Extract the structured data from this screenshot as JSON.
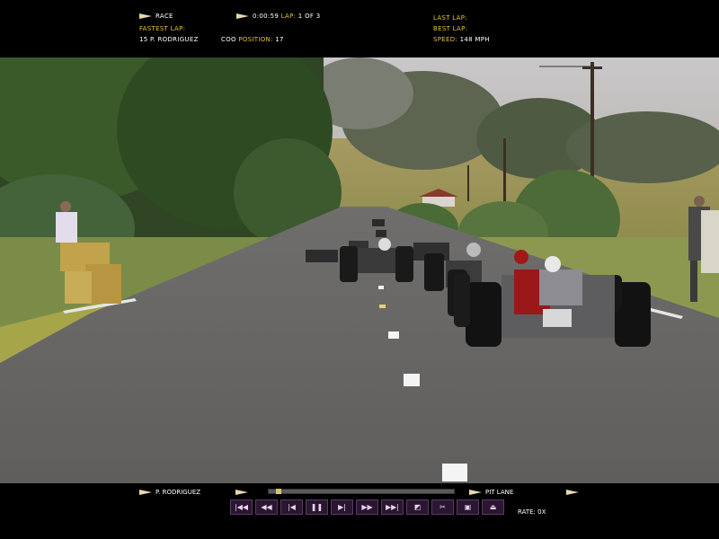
{
  "hud_top": {
    "race_label": "Race",
    "race_time": "0:00:59",
    "lap_label": "Lap:",
    "lap_value": "1 of 3",
    "fastest_lap_label": "Fastest Lap:",
    "fastest_lap_driver": "15  P. Rodriguez",
    "coo_label": "COO",
    "position_label": "Position:",
    "position_value": "17",
    "last_lap_label": "Last Lap:",
    "best_lap_label": "Best Lap:",
    "speed_label": "Speed:",
    "speed_value": "148 mph"
  },
  "hud_bottom": {
    "driver_name": "P. Rodriguez",
    "pit_lane_label": "Pit Lane",
    "rate_label": "Rate:",
    "rate_value": "0x",
    "controls": [
      {
        "name": "rewind-to-start",
        "glyph": "|◀◀"
      },
      {
        "name": "fast-rewind",
        "glyph": "◀◀"
      },
      {
        "name": "step-back",
        "glyph": "|◀"
      },
      {
        "name": "pause",
        "glyph": "❚❚"
      },
      {
        "name": "play",
        "glyph": "▶|"
      },
      {
        "name": "fast-forward",
        "glyph": "▶▶"
      },
      {
        "name": "forward-to-end",
        "glyph": "▶▶|"
      },
      {
        "name": "camera",
        "glyph": "◩"
      },
      {
        "name": "cut",
        "glyph": "✂"
      },
      {
        "name": "save",
        "glyph": "▣"
      },
      {
        "name": "eject",
        "glyph": "⏏"
      }
    ]
  },
  "colors": {
    "hud_label": "#e8c23a",
    "hud_text": "#ffffff",
    "control_bg": "#2a1630"
  }
}
